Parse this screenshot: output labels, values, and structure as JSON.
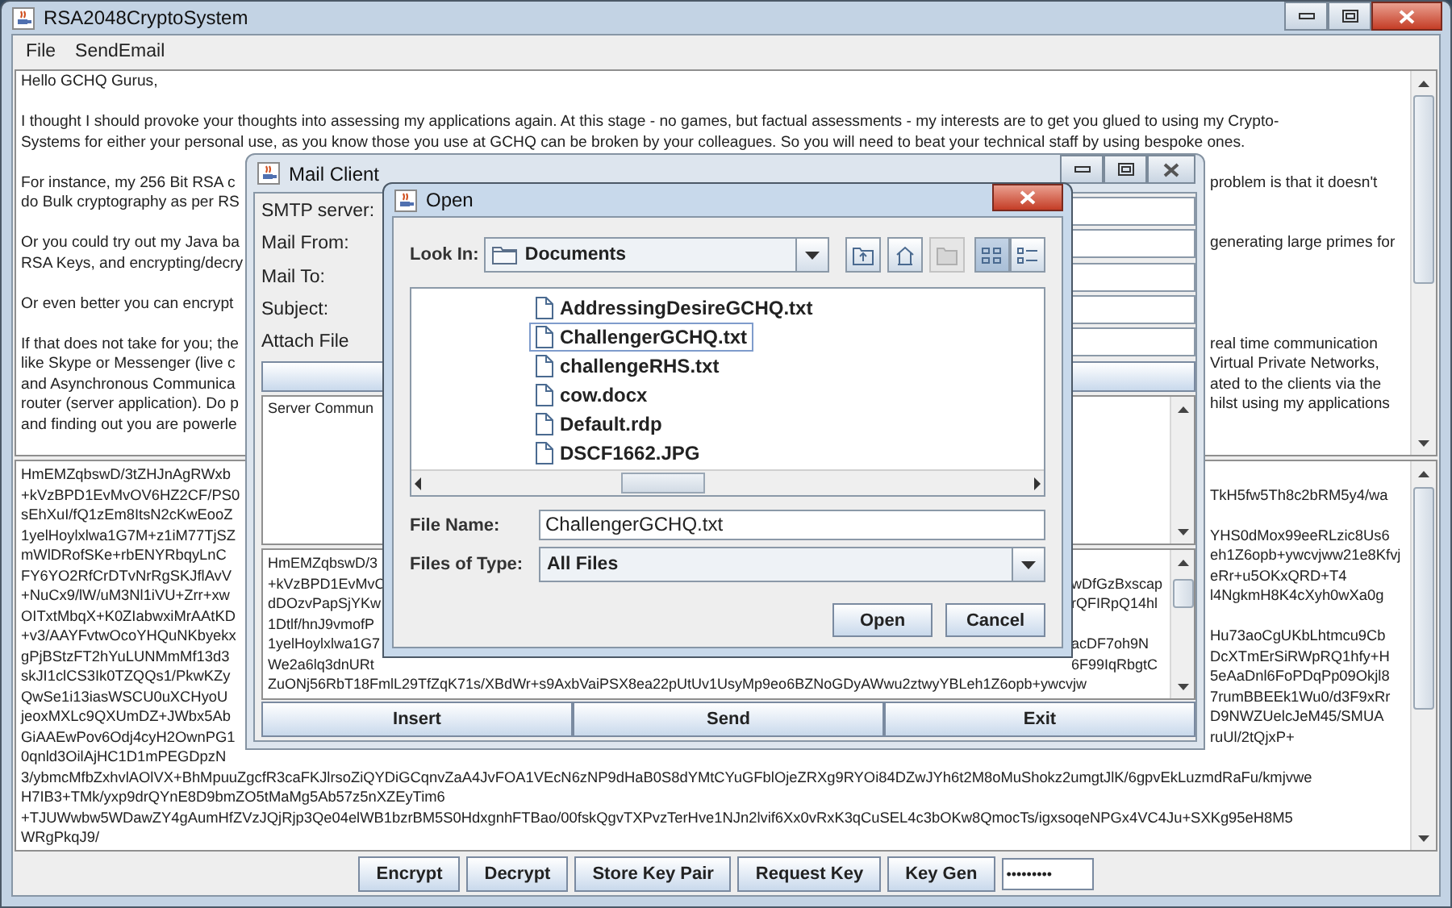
{
  "main_window": {
    "title": "RSA2048CryptoSystem",
    "menu": [
      "File",
      "SendEmail"
    ],
    "letter_lines": [
      {
        "kind": "full",
        "text": "Hello GCHQ Gurus,"
      },
      {
        "kind": "blank"
      },
      {
        "kind": "full",
        "text": "I thought I should provoke your thoughts into assessing my applications again. At this stage - no games, but factual assessments - my interests are to get you glued to using my Crypto-"
      },
      {
        "kind": "full",
        "text": "Systems for either your personal use, as you know those you use at GCHQ can be broken by your colleagues. So you will need to beat your technical staff by using bespoke ones."
      },
      {
        "kind": "blank"
      },
      {
        "kind": "split",
        "left": "For instance, my 256 Bit RSA c",
        "right": "problem is that it doesn't"
      },
      {
        "kind": "split",
        "left": "do Bulk cryptography as per RS"
      },
      {
        "kind": "blank"
      },
      {
        "kind": "split",
        "left": "Or you could try out my Java ba",
        "right": "generating large primes for"
      },
      {
        "kind": "split",
        "left": "RSA Keys, and encrypting/decry"
      },
      {
        "kind": "blank"
      },
      {
        "kind": "split",
        "left": "Or even better you can encrypt"
      },
      {
        "kind": "blank"
      },
      {
        "kind": "split",
        "left": "If that does not take for you; the",
        "right": "real time communication"
      },
      {
        "kind": "split",
        "left": "like Skype or Messenger (live c",
        "right": "Virtual Private Networks,"
      },
      {
        "kind": "split",
        "left": "and Asynchronous Communica",
        "right": "ated to the clients via the"
      },
      {
        "kind": "split",
        "left": "router (server application). Do p",
        "right": "hilst using my applications"
      },
      {
        "kind": "split",
        "left": "and finding out you are powerle"
      }
    ],
    "cipher_lines": [
      {
        "kind": "split",
        "left": "HmEMZqbswD/3tZHJnAgRWxb"
      },
      {
        "kind": "split",
        "left": "+kVzBPD1EvMvOV6HZ2CF/PS0",
        "right": "TkH5fw5Th8c2bRM5y4/wa"
      },
      {
        "kind": "split",
        "left": "sEhXuI/fQ1zEm8ItsN2cKwEooZ"
      },
      {
        "kind": "split",
        "left": "1yelHoylxlwa1G7M+z1iM77TjSZ",
        "right": "YHS0dMox99eeRLzic8Us6"
      },
      {
        "kind": "split",
        "left": "mWlDRofSKe+rbENYRbqyLnC",
        "right": "eh1Z6opb+ywcvjww21e8Kfvj"
      },
      {
        "kind": "split",
        "left": "FY6YO2RfCrDTvNrRgSKJflAvV",
        "right": "eRr+u5OKxQRD+T4"
      },
      {
        "kind": "split",
        "left": "+NuCx9/lW/uM3Nl1iVU+Zrr+xw",
        "right": "l4NgkmH8K4cXyh0wXa0g"
      },
      {
        "kind": "split",
        "left": "OITxtMbqX+K0ZIabwxiMrAAtKD"
      },
      {
        "kind": "split",
        "left": "+v3/AAYFvtwOcoYHQuNKbyekx",
        "right": "Hu73aoCgUKbLhtmcu9Cb"
      },
      {
        "kind": "split",
        "left": "gPjBStzFT2hYuLUNMmMf13d3",
        "right": "DcXTmErSiRWpRQ1hfy+H"
      },
      {
        "kind": "split",
        "left": "skJI1clCS3Ik0TZQQs1/PkwKZy",
        "right": "5eAaDnl6FoPDqPp09Okjl8"
      },
      {
        "kind": "split",
        "left": "QwSe1i13iasWSCU0uXCHyoU",
        "right": "7rumBBEEk1Wu0/d3F9xRr"
      },
      {
        "kind": "split",
        "left": "jeoxMXLc9QXUmDZ+JWbx5Ab",
        "right": "D9NWZUelcJeM45/SMUA"
      },
      {
        "kind": "split",
        "left": "GiAAEwPov6Odj4cyH2OwnPG1",
        "right": "ruUl/2tQjxP+"
      },
      {
        "kind": "split",
        "left": "0qnld3OilAjHC1D1mPEGDpzN"
      },
      {
        "kind": "full",
        "text": "3/ybmcMfbZxhvlAOlVX+BhMpuuZgcfR3caFKJlrsoZiQYDiGCqnvZaA4JvFOA1VEcN6zNP9dHaB0S8dYMtCYuGFblOjeZRXg9RYOi84DZwJYh6t2M8oMuShokz2umgtJlK/6gpvEkLuzmdRaFu/kmjvwe"
      },
      {
        "kind": "full",
        "text": "H7IB3+TMk/yxp9drQYnE8D9bmZO5tMaMg5Ab57z5nXZEyTim6"
      },
      {
        "kind": "full",
        "text": "+TJUWwbw5WDawZY4gAumHfZVzJQjRjp3Qe04elWB1bzrBM5S0HdxgnhFTBao/00fskQgvTXPvzTerHve1NJn2lvif6Xx0vRxK3qCuSEL4c3bOKw8QmocTs/igxsoqeNPGx4VC4Ju+SXKg95eH8M5"
      },
      {
        "kind": "full",
        "text": "WRgPkqJ9/"
      }
    ],
    "buttons": [
      "Encrypt",
      "Decrypt",
      "Store Key Pair",
      "Request Key",
      "Key Gen"
    ],
    "password": {
      "value": "•••••••••"
    }
  },
  "mail_client": {
    "title": "Mail Client",
    "fields": [
      {
        "label": "SMTP server:"
      },
      {
        "label": "Mail From:"
      },
      {
        "label": "Mail To:"
      },
      {
        "label": "Subject:"
      },
      {
        "label": "Attach File"
      }
    ],
    "server_log": "Server Commun",
    "message_lines": [
      {
        "kind": "split",
        "left": "HmEMZqbswD/3"
      },
      {
        "kind": "split",
        "left": "+kVzBPD1EvMvC",
        "right": "wDfGzBxscap"
      },
      {
        "kind": "split",
        "left": "dDOzvPapSjYKw",
        "right": "rQFIRpQ14hl"
      },
      {
        "kind": "split",
        "left": "1Dtlf/hnJ9vmofP"
      },
      {
        "kind": "split",
        "left": "1yelHoylxlwa1G7",
        "right": "acDF7oh9N"
      },
      {
        "kind": "split",
        "left": "We2a6lq3dnURt",
        "right": "6F99IqRbgtC"
      },
      {
        "kind": "full",
        "text": "ZuONj56RbT18FmlL29TfZqK71s/XBdWr+s9AxbVaiPSX8ea22pUtUv1UsyMp9eo6BZNoGDyAWwu2ztwyYBLeh1Z6opb+ywcvjw"
      }
    ],
    "buttons": [
      "Insert",
      "Send",
      "Exit"
    ]
  },
  "open_dialog": {
    "title": "Open",
    "look_in_label": "Look In:",
    "look_in": "Documents",
    "toolbar": [
      {
        "kind": "up-folder",
        "disabled": false
      },
      {
        "kind": "home",
        "disabled": false
      },
      {
        "kind": "new-folder",
        "disabled": true
      }
    ],
    "view_modes": [
      {
        "kind": "list",
        "selected": true
      },
      {
        "kind": "details",
        "selected": false
      }
    ],
    "files": [
      {
        "name": "AddressingDesireGCHQ.txt",
        "selected": false
      },
      {
        "name": "ChallengerGCHQ.txt",
        "selected": true
      },
      {
        "name": "challengeRHS.txt",
        "selected": false
      },
      {
        "name": "cow.docx",
        "selected": false
      },
      {
        "name": "Default.rdp",
        "selected": false
      },
      {
        "name": "DSCF1662.JPG",
        "selected": false
      }
    ],
    "file_name_label": "File Name:",
    "file_name": "ChallengerGCHQ.txt",
    "file_type_label": "Files of Type:",
    "file_type": "All Files",
    "buttons": [
      "Open",
      "Cancel"
    ]
  }
}
